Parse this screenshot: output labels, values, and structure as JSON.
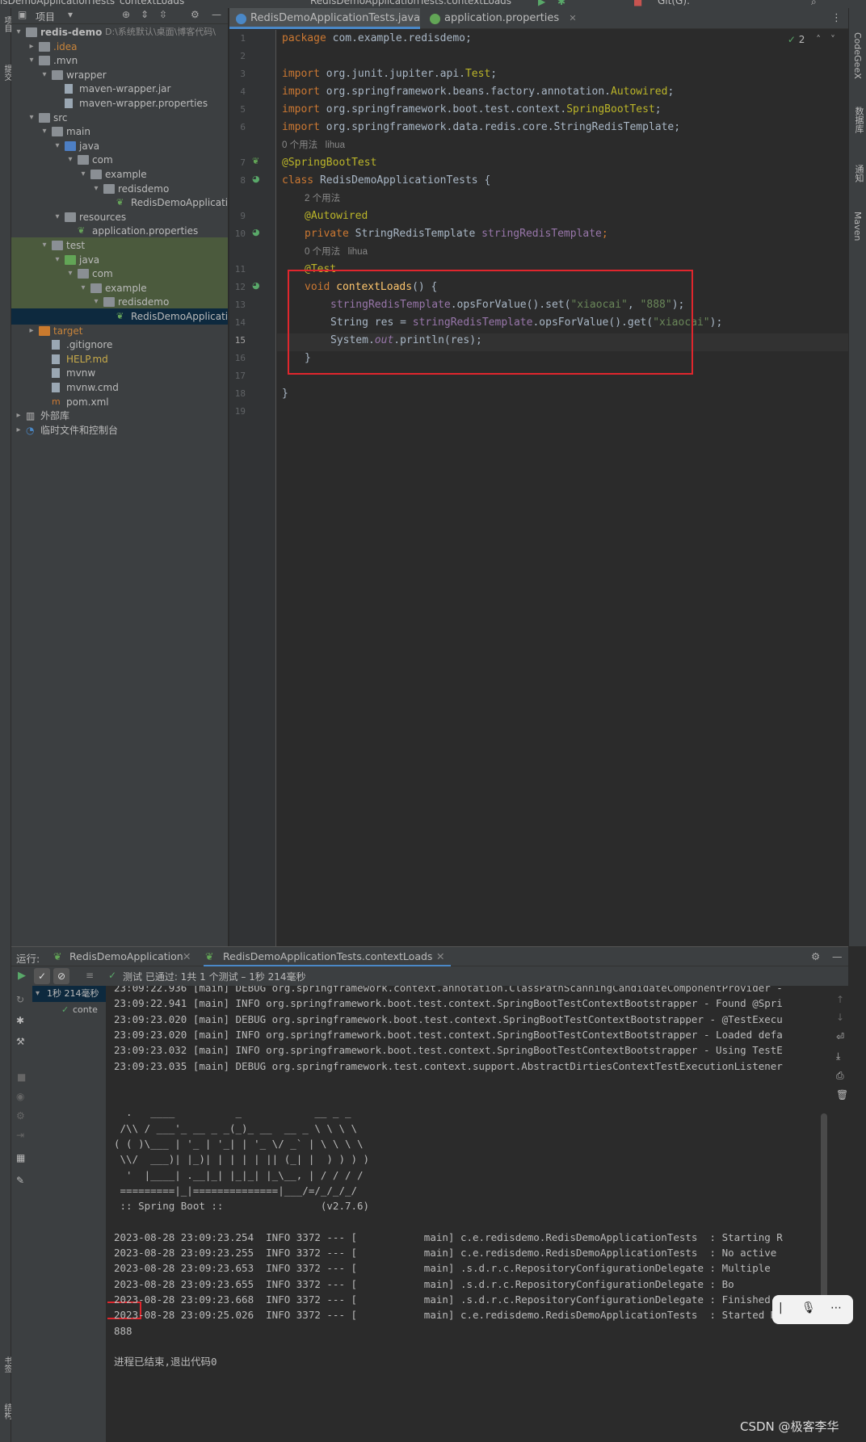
{
  "topbar": {
    "left_title": "isDemoApplicationTests",
    "method_tab": "contextLoads",
    "run_config": "RedisDemoApplicationTests.contextLoads",
    "git_label": "Git(G):"
  },
  "left_strip": {
    "project_label": "项目",
    "commit_label": "提交",
    "bookmarks_label": "书签",
    "structure_label": "结构"
  },
  "project": {
    "header_label": "项目",
    "tree": [
      {
        "label": "redis-demo",
        "extra": "D:\\系统默认\\桌面\\博客代码\\",
        "level": 0,
        "arrow": "down",
        "icon": "folder"
      },
      {
        "label": ".idea",
        "level": 1,
        "arrow": "right",
        "icon": "folder"
      },
      {
        "label": ".mvn",
        "level": 1,
        "arrow": "down",
        "icon": "folder"
      },
      {
        "label": "wrapper",
        "level": 2,
        "arrow": "down",
        "icon": "folder"
      },
      {
        "label": "maven-wrapper.jar",
        "level": 3,
        "arrow": "",
        "icon": "file"
      },
      {
        "label": "maven-wrapper.properties",
        "level": 3,
        "arrow": "",
        "icon": "file"
      },
      {
        "label": "src",
        "level": 1,
        "arrow": "down",
        "icon": "folder"
      },
      {
        "label": "main",
        "level": 2,
        "arrow": "down",
        "icon": "folder"
      },
      {
        "label": "java",
        "level": 3,
        "arrow": "down",
        "icon": "folder-blue"
      },
      {
        "label": "com",
        "level": 4,
        "arrow": "down",
        "icon": "folder"
      },
      {
        "label": "example",
        "level": 5,
        "arrow": "down",
        "icon": "folder"
      },
      {
        "label": "redisdemo",
        "level": 6,
        "arrow": "down",
        "icon": "folder"
      },
      {
        "label": "RedisDemoApplication",
        "level": 7,
        "arrow": "",
        "icon": "spring"
      },
      {
        "label": "resources",
        "level": 3,
        "arrow": "down",
        "icon": "folder"
      },
      {
        "label": "application.properties",
        "level": 4,
        "arrow": "",
        "icon": "spring"
      },
      {
        "label": "test",
        "level": 2,
        "arrow": "down",
        "icon": "folder"
      },
      {
        "label": "java",
        "level": 3,
        "arrow": "down",
        "icon": "folder-green"
      },
      {
        "label": "com",
        "level": 4,
        "arrow": "down",
        "icon": "folder"
      },
      {
        "label": "example",
        "level": 5,
        "arrow": "down",
        "icon": "folder"
      },
      {
        "label": "redisdemo",
        "level": 6,
        "arrow": "down",
        "icon": "folder"
      },
      {
        "label": "RedisDemoApplicationTests",
        "level": 7,
        "arrow": "",
        "icon": "spring"
      },
      {
        "label": "target",
        "level": 1,
        "arrow": "right",
        "icon": "folder-orange"
      },
      {
        "label": ".gitignore",
        "level": 2,
        "arrow": "",
        "icon": "file"
      },
      {
        "label": "HELP.md",
        "level": 2,
        "arrow": "",
        "icon": "file"
      },
      {
        "label": "mvnw",
        "level": 2,
        "arrow": "",
        "icon": "file"
      },
      {
        "label": "mvnw.cmd",
        "level": 2,
        "arrow": "",
        "icon": "file"
      },
      {
        "label": "pom.xml",
        "level": 2,
        "arrow": "",
        "icon": "maven"
      },
      {
        "label": "外部库",
        "level": 0,
        "arrow": "right",
        "icon": "lib"
      },
      {
        "label": "临时文件和控制台",
        "level": 0,
        "arrow": "right",
        "icon": "scratch"
      }
    ]
  },
  "editor": {
    "tabs": [
      {
        "label": "RedisDemoApplicationTests.java",
        "active": true
      },
      {
        "label": "application.properties",
        "active": false
      }
    ],
    "inspection_count": "2",
    "line_numbers": [
      "1",
      "2",
      "3",
      "4",
      "5",
      "6",
      "7",
      "8",
      "9",
      "10",
      "11",
      "12",
      "13",
      "14",
      "15",
      "16",
      "17",
      "18",
      "19"
    ],
    "hints": {
      "h1": "0 个用法   lihua",
      "h2": "2 个用法",
      "h3": "0 个用法   lihua"
    },
    "code": {
      "l1_kw": "package",
      "l1_rest": " com.example.redisdemo;",
      "l3_kw": "import",
      "l3_a": " org.junit.jupiter.api.",
      "l3_b": "Test",
      "l3_c": ";",
      "l4_kw": "import",
      "l4_a": " org.springframework.beans.factory.annotation.",
      "l4_b": "Autowired",
      "l4_c": ";",
      "l5_kw": "import",
      "l5_a": " org.springframework.boot.test.context.",
      "l5_b": "SpringBootTest",
      "l5_c": ";",
      "l6_kw": "import",
      "l6_a": " org.springframework.data.redis.core.StringRedisTemplate;",
      "l7": "@SpringBootTest",
      "l8_kw": "class",
      "l8_rest": " RedisDemoApplicationTests {",
      "l9": "@Autowired",
      "l10_kw": "private",
      "l10_a": " StringRedisTemplate ",
      "l10_b": "stringRedisTemplate",
      "l10_c": ";",
      "l11": "@Test",
      "l12_kw": "void",
      "l12_fn": " contextLoads",
      "l12_rest": "() {",
      "l13_a": "stringRedisTemplate",
      "l13_b": ".opsForValue().set(",
      "l13_s1": "\"xiaocai\"",
      "l13_c": ", ",
      "l13_s2": "\"888\"",
      "l13_d": ");",
      "l14_a": "String res = ",
      "l14_b": "stringRedisTemplate",
      "l14_c": ".opsForValue().get(",
      "l14_s": "\"xiaocai\"",
      "l14_d": ");",
      "l15_a": "System.",
      "l15_b": "out",
      "l15_c": ".println(res);",
      "l16": "}",
      "l18": "}"
    }
  },
  "right_strip": {
    "codegeex": "CodeGeeX",
    "database": "数据库",
    "notify": "通知",
    "maven": "Maven"
  },
  "run": {
    "label": "运行:",
    "tab1": "RedisDemoApplication",
    "tab2": "RedisDemoApplicationTests.contextLoads",
    "status": "测试 已通过: 1共 1 个测试 – 1秒 214毫秒",
    "tree_root": "1秒 214毫秒",
    "tree_child": "conte",
    "console": [
      "23:09:22.936 [main] DEBUG org.springframework.context.annotation.ClassPathScanningCandidateComponentProvider -",
      "23:09:22.941 [main] INFO org.springframework.boot.test.context.SpringBootTestContextBootstrapper - Found @Spri",
      "23:09:23.020 [main] DEBUG org.springframework.boot.test.context.SpringBootTestContextBootstrapper - @TestExecu",
      "23:09:23.020 [main] INFO org.springframework.boot.test.context.SpringBootTestContextBootstrapper - Loaded defa",
      "23:09:23.032 [main] INFO org.springframework.boot.test.context.SpringBootTestContextBootstrapper - Using TestE",
      "23:09:23.035 [main] DEBUG org.springframework.test.context.support.AbstractDirtiesContextTestExecutionListener",
      "",
      "",
      "  .   ____          _            __ _ _",
      " /\\\\ / ___'_ __ _ _(_)_ __  __ _ \\ \\ \\ \\",
      "( ( )\\___ | '_ | '_| | '_ \\/ _` | \\ \\ \\ \\",
      " \\\\/  ___)| |_)| | | | | || (_| |  ) ) ) )",
      "  '  |____| .__|_| |_|_| |_\\__, | / / / /",
      " =========|_|==============|___/=/_/_/_/",
      " :: Spring Boot ::                (v2.7.6)",
      "",
      "2023-08-28 23:09:23.254  INFO 3372 --- [           main] c.e.redisdemo.RedisDemoApplicationTests  : Starting R",
      "2023-08-28 23:09:23.255  INFO 3372 --- [           main] c.e.redisdemo.RedisDemoApplicationTests  : No active",
      "2023-08-28 23:09:23.653  INFO 3372 --- [           main] .s.d.r.c.RepositoryConfigurationDelegate : Multiple",
      "2023-08-28 23:09:23.655  INFO 3372 --- [           main] .s.d.r.c.RepositoryConfigurationDelegate : Bo",
      "2023-08-28 23:09:23.668  INFO 3372 --- [           main] .s.d.r.c.RepositoryConfigurationDelegate : Finished S",
      "2023-08-28 23:09:25.026  INFO 3372 --- [           main] c.e.redisdemo.RedisDemoApplicationTests  : Started Re",
      "888",
      "",
      "进程已结束,退出代码0"
    ]
  },
  "watermark": "CSDN @极客李华",
  "colors": {
    "bg": "#2b2b2b",
    "panel": "#3c3f41",
    "keyword": "#cc7832",
    "annotation": "#bbb529",
    "string": "#6a8759",
    "field": "#9876aa",
    "highlight_box": "#e0262d"
  }
}
